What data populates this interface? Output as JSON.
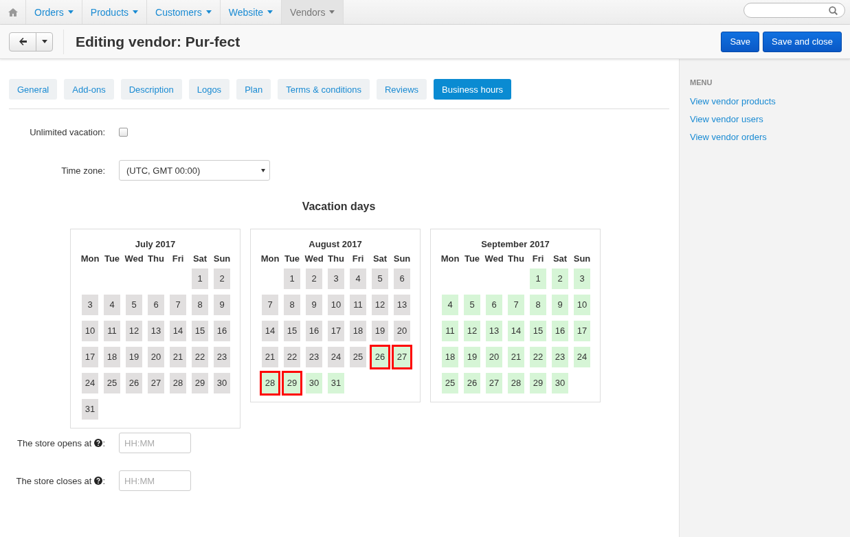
{
  "top_nav": {
    "items": [
      {
        "label": "Orders",
        "selected": false
      },
      {
        "label": "Products",
        "selected": false
      },
      {
        "label": "Customers",
        "selected": false
      },
      {
        "label": "Website",
        "selected": false
      },
      {
        "label": "Vendors",
        "selected": true
      }
    ]
  },
  "header": {
    "title": "Editing vendor: Pur-fect",
    "buttons": [
      {
        "label": "Save"
      },
      {
        "label": "Save and close"
      }
    ]
  },
  "tabs": [
    {
      "label": "General",
      "selected": false
    },
    {
      "label": "Add-ons",
      "selected": false
    },
    {
      "label": "Description",
      "selected": false
    },
    {
      "label": "Logos",
      "selected": false
    },
    {
      "label": "Plan",
      "selected": false
    },
    {
      "label": "Terms & conditions",
      "selected": false
    },
    {
      "label": "Reviews",
      "selected": false
    },
    {
      "label": "Business hours",
      "selected": true
    }
  ],
  "unlimited_vacation": {
    "label": "Unlimited vacation:",
    "checked": false
  },
  "time_zone": {
    "label": "Time zone:",
    "value": "(UTC, GMT 00:00)"
  },
  "vacation_days": {
    "title": "Vacation days",
    "months": [
      {
        "title": "July 2017",
        "weekdays": [
          "Mon",
          "Tue",
          "Wed",
          "Thu",
          "Fri",
          "Sat",
          "Sun"
        ],
        "weeks": [
          [
            {
              "label": "1",
              "past": true,
              "selected": false
            },
            {
              "label": "2",
              "past": true,
              "selected": false
            }
          ],
          [
            {
              "label": "3",
              "past": true,
              "selected": false
            },
            {
              "label": "4",
              "past": true,
              "selected": false
            },
            {
              "label": "5",
              "past": true,
              "selected": false
            },
            {
              "label": "6",
              "past": true,
              "selected": false
            },
            {
              "label": "7",
              "past": true,
              "selected": false
            },
            {
              "label": "8",
              "past": true,
              "selected": false
            },
            {
              "label": "9",
              "past": true,
              "selected": false
            }
          ],
          [
            {
              "label": "10",
              "past": true,
              "selected": false
            },
            {
              "label": "11",
              "past": true,
              "selected": false
            },
            {
              "label": "12",
              "past": true,
              "selected": false
            },
            {
              "label": "13",
              "past": true,
              "selected": false
            },
            {
              "label": "14",
              "past": true,
              "selected": false
            },
            {
              "label": "15",
              "past": true,
              "selected": false
            },
            {
              "label": "16",
              "past": true,
              "selected": false
            }
          ],
          [
            {
              "label": "17",
              "past": true,
              "selected": false
            },
            {
              "label": "18",
              "past": true,
              "selected": false
            },
            {
              "label": "19",
              "past": true,
              "selected": false
            },
            {
              "label": "20",
              "past": true,
              "selected": false
            },
            {
              "label": "21",
              "past": true,
              "selected": false
            },
            {
              "label": "22",
              "past": true,
              "selected": false
            },
            {
              "label": "23",
              "past": true,
              "selected": false
            }
          ],
          [
            {
              "label": "24",
              "past": true,
              "selected": false
            },
            {
              "label": "25",
              "past": true,
              "selected": false
            },
            {
              "label": "26",
              "past": true,
              "selected": false
            },
            {
              "label": "27",
              "past": true,
              "selected": false
            },
            {
              "label": "28",
              "past": true,
              "selected": false
            },
            {
              "label": "29",
              "past": true,
              "selected": false
            },
            {
              "label": "30",
              "past": true,
              "selected": false
            }
          ],
          [
            {
              "label": "31",
              "past": true,
              "selected": false
            }
          ]
        ]
      },
      {
        "title": "August 2017",
        "weekdays": [
          "Mon",
          "Tue",
          "Wed",
          "Thu",
          "Fri",
          "Sat",
          "Sun"
        ],
        "weeks": [
          [
            {
              "label": "1",
              "past": true,
              "selected": false
            },
            {
              "label": "2",
              "past": true,
              "selected": false
            },
            {
              "label": "3",
              "past": true,
              "selected": false
            },
            {
              "label": "4",
              "past": true,
              "selected": false
            },
            {
              "label": "5",
              "past": true,
              "selected": false
            },
            {
              "label": "6",
              "past": true,
              "selected": false
            }
          ],
          [
            {
              "label": "7",
              "past": true,
              "selected": false
            },
            {
              "label": "8",
              "past": true,
              "selected": false
            },
            {
              "label": "9",
              "past": true,
              "selected": false
            },
            {
              "label": "10",
              "past": true,
              "selected": false
            },
            {
              "label": "11",
              "past": true,
              "selected": false
            },
            {
              "label": "12",
              "past": true,
              "selected": false
            },
            {
              "label": "13",
              "past": true,
              "selected": false
            }
          ],
          [
            {
              "label": "14",
              "past": true,
              "selected": false
            },
            {
              "label": "15",
              "past": true,
              "selected": false
            },
            {
              "label": "16",
              "past": true,
              "selected": false
            },
            {
              "label": "17",
              "past": true,
              "selected": false
            },
            {
              "label": "18",
              "past": true,
              "selected": false
            },
            {
              "label": "19",
              "past": true,
              "selected": false
            },
            {
              "label": "20",
              "past": true,
              "selected": false
            }
          ],
          [
            {
              "label": "21",
              "past": true,
              "selected": false
            },
            {
              "label": "22",
              "past": true,
              "selected": false
            },
            {
              "label": "23",
              "past": true,
              "selected": false
            },
            {
              "label": "24",
              "past": true,
              "selected": false
            },
            {
              "label": "25",
              "past": true,
              "selected": false
            },
            {
              "label": "26",
              "past": false,
              "selected": true
            },
            {
              "label": "27",
              "past": false,
              "selected": true
            }
          ],
          [
            {
              "label": "28",
              "past": false,
              "selected": true
            },
            {
              "label": "29",
              "past": false,
              "selected": true
            },
            {
              "label": "30",
              "past": false,
              "selected": false
            },
            {
              "label": "31",
              "past": false,
              "selected": false
            }
          ]
        ]
      },
      {
        "title": "September 2017",
        "weekdays": [
          "Mon",
          "Tue",
          "Wed",
          "Thu",
          "Fri",
          "Sat",
          "Sun"
        ],
        "weeks": [
          [
            {
              "label": "1",
              "past": false,
              "selected": false
            },
            {
              "label": "2",
              "past": false,
              "selected": false
            },
            {
              "label": "3",
              "past": false,
              "selected": false
            }
          ],
          [
            {
              "label": "4",
              "past": false,
              "selected": false
            },
            {
              "label": "5",
              "past": false,
              "selected": false
            },
            {
              "label": "6",
              "past": false,
              "selected": false
            },
            {
              "label": "7",
              "past": false,
              "selected": false
            },
            {
              "label": "8",
              "past": false,
              "selected": false
            },
            {
              "label": "9",
              "past": false,
              "selected": false
            },
            {
              "label": "10",
              "past": false,
              "selected": false
            }
          ],
          [
            {
              "label": "11",
              "past": false,
              "selected": false
            },
            {
              "label": "12",
              "past": false,
              "selected": false
            },
            {
              "label": "13",
              "past": false,
              "selected": false
            },
            {
              "label": "14",
              "past": false,
              "selected": false
            },
            {
              "label": "15",
              "past": false,
              "selected": false
            },
            {
              "label": "16",
              "past": false,
              "selected": false
            },
            {
              "label": "17",
              "past": false,
              "selected": false
            }
          ],
          [
            {
              "label": "18",
              "past": false,
              "selected": false
            },
            {
              "label": "19",
              "past": false,
              "selected": false
            },
            {
              "label": "20",
              "past": false,
              "selected": false
            },
            {
              "label": "21",
              "past": false,
              "selected": false
            },
            {
              "label": "22",
              "past": false,
              "selected": false
            },
            {
              "label": "23",
              "past": false,
              "selected": false
            },
            {
              "label": "24",
              "past": false,
              "selected": false
            }
          ],
          [
            {
              "label": "25",
              "past": false,
              "selected": false
            },
            {
              "label": "26",
              "past": false,
              "selected": false
            },
            {
              "label": "27",
              "past": false,
              "selected": false
            },
            {
              "label": "28",
              "past": false,
              "selected": false
            },
            {
              "label": "29",
              "past": false,
              "selected": false
            },
            {
              "label": "30",
              "past": false,
              "selected": false
            }
          ]
        ]
      }
    ]
  },
  "hours": [
    {
      "label": "The store opens at",
      "suffix": ":",
      "placeholder": "HH:MM"
    },
    {
      "label": "The store closes at",
      "suffix": ":",
      "placeholder": "HH:MM"
    }
  ],
  "sidebar": {
    "heading": "MENU",
    "links": [
      "View vendor products",
      "View vendor users",
      "View vendor orders"
    ]
  }
}
